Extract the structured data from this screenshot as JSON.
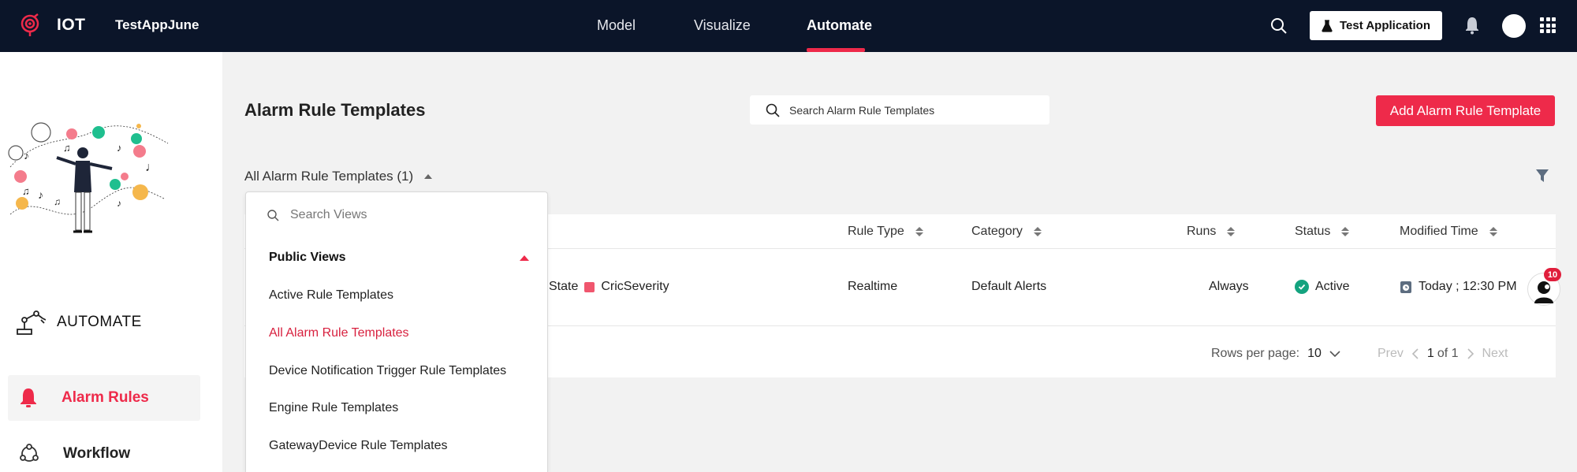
{
  "topbar": {
    "brand": "IOT",
    "app_name": "TestAppJune",
    "nav": [
      "Model",
      "Visualize",
      "Automate"
    ],
    "active_nav": "Automate",
    "app_button_label": "Test Application",
    "accent_color": "#ee2a4a",
    "background_color": "#0b1529"
  },
  "sidebar": {
    "section_title": "AUTOMATE",
    "items": [
      {
        "label": "Alarm Rules",
        "icon": "bell-icon",
        "active": true
      },
      {
        "label": "Workflow",
        "icon": "workflow-icon",
        "active": false
      }
    ]
  },
  "main": {
    "title": "Alarm Rule Templates",
    "search_placeholder": "Search Alarm Rule Templates",
    "add_button_label": "Add Alarm Rule Template",
    "view_selector_label": "All Alarm Rule Templates (1)"
  },
  "table": {
    "columns": [
      "Rule Type",
      "Category",
      "Runs",
      "Status",
      "Modified Time"
    ],
    "rows": [
      {
        "state": "State",
        "severity": "CricSeverity",
        "rule_type": "Realtime",
        "category": "Default Alerts",
        "runs": "Always",
        "status": "Active",
        "modified_time": "Today ; 12:30 PM"
      }
    ],
    "pagination": {
      "rows_per_page_label": "Rows per page:",
      "rows_per_page": "10",
      "prev_label": "Prev",
      "current_page": "1",
      "of_label": "of 1",
      "next_label": "Next"
    }
  },
  "chat": {
    "badge_count": "10"
  },
  "dropdown": {
    "search_placeholder": "Search Views",
    "section_title": "Public Views",
    "items": [
      "Active Rule Templates",
      "All Alarm Rule Templates",
      "Device Notification Trigger Rule Templates",
      "Engine Rule Templates",
      "GatewayDevice Rule Templates"
    ],
    "selected_index": 1
  }
}
